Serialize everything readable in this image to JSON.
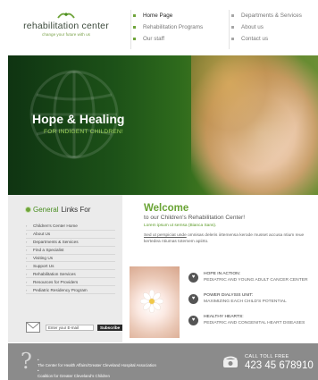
{
  "logo": {
    "title": "rehabilitation center",
    "tagline": "change your future with us",
    "icon": "leaf-icon"
  },
  "nav": {
    "col1": [
      {
        "label": "Home Page",
        "active": true
      },
      {
        "label": "Rehabilitation Programs",
        "active": false
      },
      {
        "label": "Our staff",
        "active": false
      }
    ],
    "col2": [
      {
        "label": "Departments & Services"
      },
      {
        "label": "About us"
      },
      {
        "label": "Contact us"
      }
    ]
  },
  "hero": {
    "title": "Hope & Healing",
    "subtitle": "FOR INDIGENT CHILDREN!"
  },
  "sidebar": {
    "heading_green": "General",
    "heading_rest": "Links For",
    "items": [
      "Children's Center Home",
      "About Us",
      "Departments & Services",
      "Find a Specialist",
      "Visiting Us",
      "Support Us",
      "Rehabilitation Services",
      "Resources for Providers",
      "Pediatric Residency Program"
    ],
    "newsletter": {
      "placeholder": "Enter your E-mail",
      "button": "Subscribe"
    }
  },
  "welcome": {
    "title": "Welcome",
    "subtitle": "to our Children's Rehabilitation Center!",
    "link": "Lorem ipsum ut semsa (Bianca Sans).",
    "body_link": "Sed ut perspiciat unde",
    "body_rest": " omnisas deleris iirtemensa kerode musset accusa ntium reue kertedea ntiumas totemem apiirto."
  },
  "services": [
    {
      "icon": "heart-icon",
      "title": "HOPE IN ACTION:",
      "desc": "PEDIATRIC AND YOUNG ADULT CANCER CENTER"
    },
    {
      "icon": "heart-icon",
      "title": "POWER DIALYSIS UNIT:",
      "desc": "MAXIMIZING EACH CHILD'S POTENTIAL"
    },
    {
      "icon": "heart-icon",
      "title": "HEALTHY HEARTS:",
      "desc": "PEDIATRIC AND CONGENITAL HEART DISEASES"
    }
  ],
  "footer": {
    "links": [
      "The Center for Health Affairs/Greater Cleveland Hospital Association",
      "Coalition for Greater Cleveland's Children"
    ],
    "call_label": "CALL TOLL FREE",
    "call_number": "423 45 678910"
  }
}
